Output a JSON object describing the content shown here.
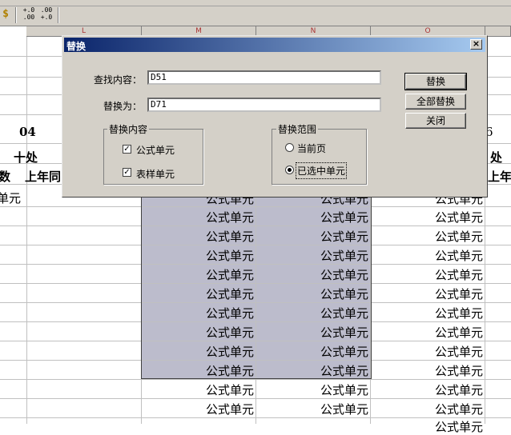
{
  "toolbar": {
    "currency_icon_glyph": "$",
    "increase_decimal_top": "+.0",
    "increase_decimal_bottom": ".00",
    "decrease_decimal_top": ".00",
    "decrease_decimal_bottom": "+.0"
  },
  "sheet": {
    "column_letters": [
      "L",
      "M",
      "N",
      "O"
    ],
    "partial_texts": {
      "row04": "04",
      "row_shichu_left": "十处",
      "row_shichu_right": "处",
      "row_shu": "数",
      "row_shangnian_left": "上年同",
      "row_shangnian_right": "上年同",
      "row_six": "6",
      "first_cell": "单元"
    },
    "cell_value": "公式单元",
    "rows_m": [
      "公式单元",
      "公式单元",
      "公式单元",
      "公式单元",
      "公式单元",
      "公式单元",
      "公式单元",
      "公式单元",
      "公式单元",
      "公式单元",
      "公式单元",
      "公式单元"
    ],
    "rows_n": [
      "公式单元",
      "公式单元",
      "公式单元",
      "公式单元",
      "公式单元",
      "公式单元",
      "公式单元",
      "公式单元",
      "公式单元",
      "公式单元",
      "公式单元",
      "公式单元"
    ],
    "rows_o": [
      "公式单元",
      "公式单元",
      "公式单元",
      "公式单元",
      "公式单元",
      "公式单元",
      "公式单元",
      "公式单元",
      "公式单元",
      "公式单元",
      "公式单元",
      "公式单元",
      "公式单元"
    ]
  },
  "dialog": {
    "title": "替换",
    "close_glyph": "×",
    "find_label": "查找内容：",
    "find_value": "D51",
    "replace_label": "替换为：",
    "replace_value": "D71",
    "buttons": {
      "replace": "替换",
      "replace_all": "全部替换",
      "close": "关闭"
    },
    "content_group": {
      "title": "替换内容",
      "formula_cells": {
        "label": "公式单元",
        "checked": true
      },
      "sample_cells": {
        "label": "表样单元",
        "checked": true
      }
    },
    "scope_group": {
      "title": "替换范围",
      "current_page": {
        "label": "当前页",
        "selected": false
      },
      "selected_cells": {
        "label": "已选中单元",
        "selected": true
      }
    }
  }
}
